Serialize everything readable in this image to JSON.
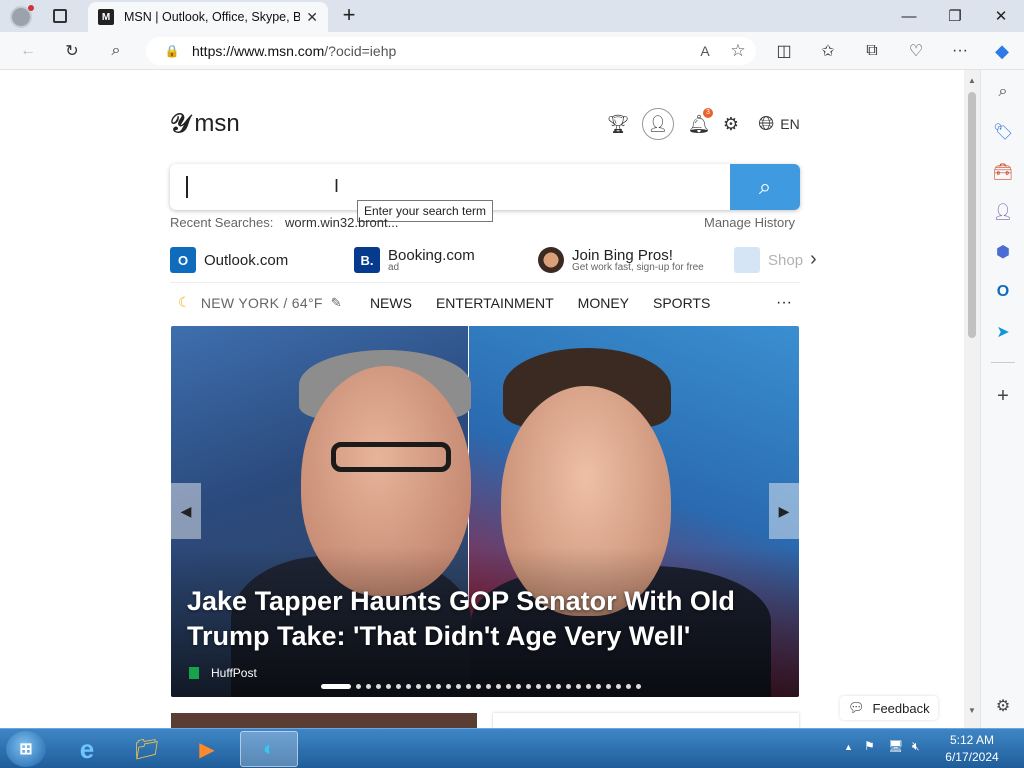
{
  "browser": {
    "tab_title": "MSN | Outlook, Office, Skype, Bi",
    "tab_favicon_letter": "M",
    "url_domain": "https://www.msn.com",
    "url_query": "/?ocid=iehp",
    "reader_label": "A",
    "new_tab_label": "+"
  },
  "header": {
    "logo_text": "msn",
    "language": "EN",
    "notification_count": "3"
  },
  "search": {
    "tooltip": "Enter your search term",
    "recent_label": "Recent Searches:",
    "recent_item": "worm.win32.bront...",
    "manage_history": "Manage History"
  },
  "quick_links": [
    {
      "label": "Outlook.com",
      "sub": "",
      "icon_letter": "O",
      "color": "#0f6cbd"
    },
    {
      "label": "Booking.com",
      "sub": "ad",
      "icon_letter": "B.",
      "color": "#063a8c"
    },
    {
      "label": "Join Bing Pros!",
      "sub": "Get work fast, sign-up for free",
      "icon_letter": "",
      "color": "#ffffff"
    },
    {
      "label": "Shop",
      "sub": "",
      "icon_letter": "",
      "color": "#ffffff"
    }
  ],
  "nav": {
    "weather": "NEW YORK / 64°F",
    "categories": [
      "NEWS",
      "ENTERTAINMENT",
      "MONEY",
      "SPORTS"
    ],
    "more": "···"
  },
  "hero": {
    "headline": "Jake Tapper Haunts GOP Senator With Old Trump Take: 'That Didn't Age Very Well'",
    "source": "HuffPost",
    "slide_count": 30,
    "active_slide": 1
  },
  "feedback": "Feedback",
  "taskbar": {
    "time": "5:12 AM",
    "date": "6/17/2024"
  }
}
